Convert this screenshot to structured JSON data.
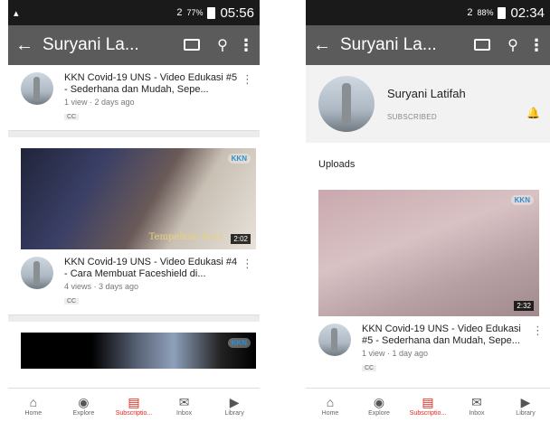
{
  "left": {
    "status": {
      "time": "05:56",
      "battery": "77%",
      "signal": "2"
    },
    "appbar": {
      "title": "Suryani La..."
    },
    "videos": [
      {
        "title": "KKN Covid-19 UNS - Video Edukasi #5 - Sederhana dan Mudah, Sepe...",
        "meta": "1 view · 2 days ago",
        "cc": "CC"
      },
      {
        "title": "KKN Covid-19 UNS - Video Edukasi #4 - Cara Membuat Faceshield di...",
        "meta": "4 views · 3 days ago",
        "cc": "CC",
        "duration": "2:02",
        "caption": "Tempelkan busa",
        "logo": "KKN"
      }
    ],
    "third_thumb_logo": "KKN"
  },
  "right": {
    "status": {
      "time": "02:34",
      "battery": "88%",
      "signal": "2"
    },
    "appbar": {
      "title": "Suryani La..."
    },
    "channel": {
      "name": "Suryani Latifah",
      "subscribed": "SUBSCRIBED"
    },
    "uploads_label": "Uploads",
    "video": {
      "title": "KKN Covid-19 UNS - Video Edukasi #5 - Sederhana dan Mudah, Sepe...",
      "meta": "1 view · 1 day ago",
      "cc": "CC",
      "duration": "2:32",
      "logo": "KKN"
    }
  },
  "nav": {
    "home": "Home",
    "explore": "Explore",
    "subscriptions": "Subscriptio...",
    "inbox": "Inbox",
    "library": "Library"
  },
  "colors": {
    "appbar": "#5b5b5b",
    "active": "#e62117"
  },
  "icons": [
    "back-arrow-icon",
    "cast-icon",
    "search-icon",
    "more-vert-icon",
    "bell-icon",
    "home-icon",
    "explore-icon",
    "subscriptions-icon",
    "inbox-icon",
    "library-icon"
  ]
}
